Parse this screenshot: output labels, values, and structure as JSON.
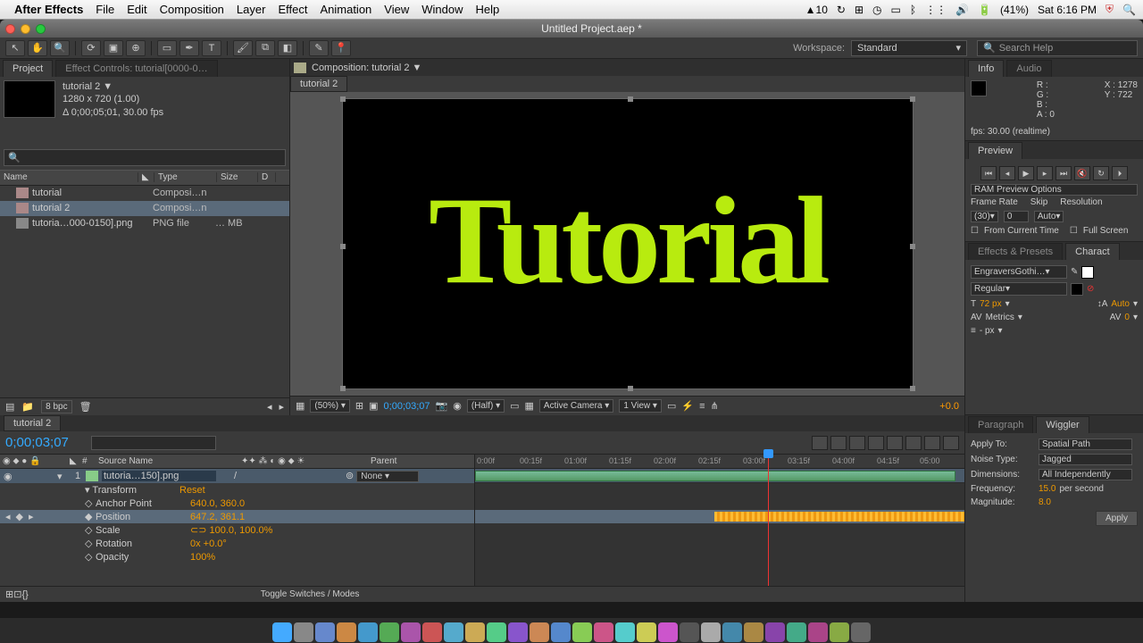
{
  "menubar": {
    "app": "After Effects",
    "items": [
      "File",
      "Edit",
      "Composition",
      "Layer",
      "Effect",
      "Animation",
      "View",
      "Window",
      "Help"
    ],
    "adobe": "10",
    "battery": "(41%)",
    "clock": "Sat 6:16 PM"
  },
  "window": {
    "title": "Untitled Project.aep *"
  },
  "toolbar": {
    "workspace_label": "Workspace:",
    "workspace_value": "Standard",
    "search_placeholder": "Search Help"
  },
  "project": {
    "tab_project": "Project",
    "tab_effectctrl": "Effect Controls: tutorial[0000-0…",
    "comp_name": "tutorial 2 ▼",
    "dims": "1280 x 720 (1.00)",
    "dur": "Δ 0;00;05;01, 30.00 fps",
    "cols": {
      "name": "Name",
      "type": "Type",
      "size": "Size",
      "d": "D"
    },
    "rows": [
      {
        "name": "tutorial",
        "type": "Composi…n",
        "size": ""
      },
      {
        "name": "tutorial 2",
        "type": "Composi…n",
        "size": "",
        "sel": true
      },
      {
        "name": "tutoria…000-0150].png",
        "type": "PNG file",
        "size": "… MB"
      }
    ],
    "bpc": "8 bpc"
  },
  "comp": {
    "path": "Composition: tutorial 2 ▼",
    "tab": "tutorial 2",
    "text": "Tutorial",
    "zoom": "(50%)",
    "time": "0;00;03;07",
    "res": "(Half)",
    "cam": "Active Camera",
    "view": "1 View",
    "exposure": "+0.0"
  },
  "info": {
    "tab_info": "Info",
    "tab_audio": "Audio",
    "r": "R :",
    "g": "G :",
    "b": "B :",
    "a": "A :  0",
    "x": "X : 1278",
    "y": "Y :  722",
    "fps": "fps: 30.00 (realtime)"
  },
  "preview": {
    "tab": "Preview",
    "ram": "RAM Preview Options",
    "fr_label": "Frame Rate",
    "sk_label": "Skip",
    "res_label": "Resolution",
    "fr": "(30)",
    "sk": "0",
    "res": "Auto",
    "from": "From Current Time",
    "full": "Full Screen"
  },
  "char": {
    "tab_ep": "Effects & Presets",
    "tab_char": "Charact",
    "font": "EngraversGothi…",
    "style": "Regular",
    "size_lbl": "T",
    "size": "72 px",
    "lead": "Auto",
    "kern": "Metrics",
    "track": "0",
    "stroke": "- px"
  },
  "timeline": {
    "tab": "tutorial 2",
    "time": "0;00;03;07",
    "cols": {
      "num": "#",
      "src": "Source Name",
      "par": "Parent"
    },
    "layer": {
      "num": "1",
      "name": "tutoria…150].png",
      "parent": "None"
    },
    "transform": "Transform",
    "reset": "Reset",
    "props": {
      "anchor": {
        "lbl": "Anchor Point",
        "val": "640.0, 360.0"
      },
      "position": {
        "lbl": "Position",
        "val": "647.2, 361.1"
      },
      "scale": {
        "lbl": "Scale",
        "val": "100.0, 100.0%"
      },
      "rotation": {
        "lbl": "Rotation",
        "val": "0x +0.0°"
      },
      "opacity": {
        "lbl": "Opacity",
        "val": "100%"
      }
    },
    "ruler": [
      "0:00f",
      "00:15f",
      "01:00f",
      "01:15f",
      "02:00f",
      "02:15f",
      "03:00f",
      "03:15f",
      "04:00f",
      "04:15f",
      "05:00"
    ],
    "toggle": "Toggle Switches / Modes"
  },
  "wiggler": {
    "tab_para": "Paragraph",
    "tab_wig": "Wiggler",
    "apply_lbl": "Apply To:",
    "apply": "Spatial Path",
    "noise_lbl": "Noise Type:",
    "noise": "Jagged",
    "dim_lbl": "Dimensions:",
    "dim": "All Independently",
    "freq_lbl": "Frequency:",
    "freq": "15.0",
    "freq_unit": "per second",
    "mag_lbl": "Magnitude:",
    "mag": "8.0",
    "btn": "Apply"
  }
}
